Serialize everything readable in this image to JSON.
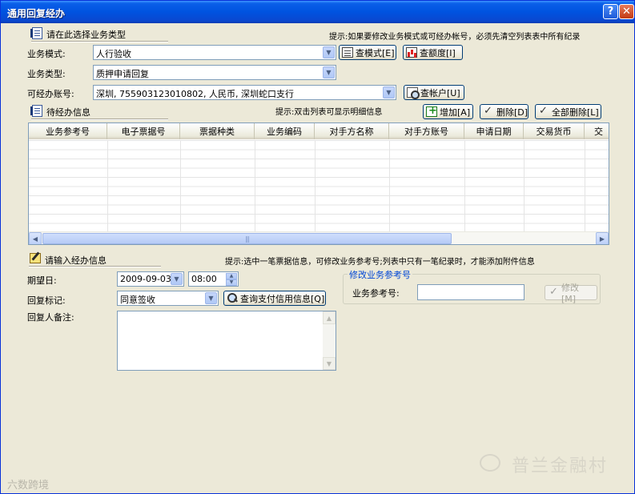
{
  "window": {
    "title": "通用回复经办",
    "help_label": "?",
    "close_label": "✕"
  },
  "select_section": {
    "title": "请在此选择业务类型",
    "hint": "提示:如果要修改业务模式或可经办帐号，必须先清空列表表中所有纪录",
    "mode_label": "业务模式:",
    "mode_value": "人行验收",
    "type_label": "业务类型:",
    "type_value": "质押申请回复",
    "account_label": "可经办账号:",
    "account_value": "深圳, 755903123010802, 人民币, 深圳蛇口支行",
    "btn_query_mode": "查模式[E]",
    "btn_query_quota": "查额度[I]",
    "btn_query_account": "查帐户[U]"
  },
  "pending_section": {
    "title": "待经办信息",
    "hint": "提示:双击列表可显示明细信息",
    "btn_add": "增加[A]",
    "btn_delete": "删除[D]",
    "btn_delete_all": "全部删除[L]",
    "columns": [
      "业务参考号",
      "电子票据号",
      "票据种类",
      "业务编码",
      "对手方名称",
      "对手方账号",
      "申请日期",
      "交易货币",
      "交"
    ],
    "scroll_left": "◀",
    "scroll_right": "▶",
    "scroll_grip": "|||"
  },
  "input_section": {
    "title": "请输入经办信息",
    "hint": "提示:选中一笔票据信息，可修改业务参考号;列表中只有一笔纪录时，才能添加附件信息",
    "expected_date_label": "期望日:",
    "expected_date_value": "2009-09-03",
    "expected_time_value": "08:00",
    "reply_flag_label": "回复标记:",
    "reply_flag_value": "同意签收",
    "btn_query_credit": "查询支付信用信息[Q]",
    "remark_label": "回复人备注:",
    "modify_group_title": "修改业务参考号",
    "ref_no_label": "业务参考号:",
    "ref_no_value": "",
    "btn_modify": "修改[M]"
  },
  "watermarks": {
    "brand": "普兰金融村",
    "corner": "六数跨境"
  }
}
